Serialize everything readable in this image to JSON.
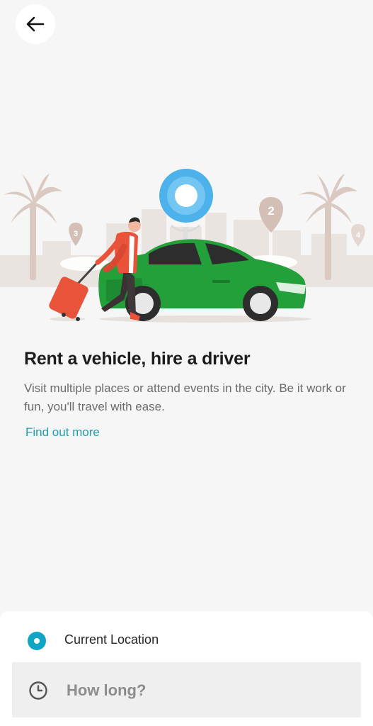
{
  "header": {
    "back_icon": "arrow-left-icon"
  },
  "promo": {
    "illustration_icons": [
      "palm-tree-icon",
      "map-pin-icon",
      "person-with-suitcase-icon",
      "car-icon"
    ],
    "pin_numbers": [
      "3",
      "2",
      "4"
    ],
    "title": "Rent a vehicle, hire a driver",
    "description": "Visit multiple places or attend events in the city. Be it work or fun, you'll travel with ease.",
    "link_label": "Find out more"
  },
  "booking": {
    "location_label": "Current Location",
    "duration_placeholder": "How long?",
    "location_icon": "location-dot-icon",
    "duration_icon": "clock-icon"
  },
  "colors": {
    "accent": "#0ea5c6",
    "link": "#1aa0b0",
    "car": "#24a03b",
    "pin_blue": "#4db2ec",
    "suitcase": "#e8533a"
  }
}
